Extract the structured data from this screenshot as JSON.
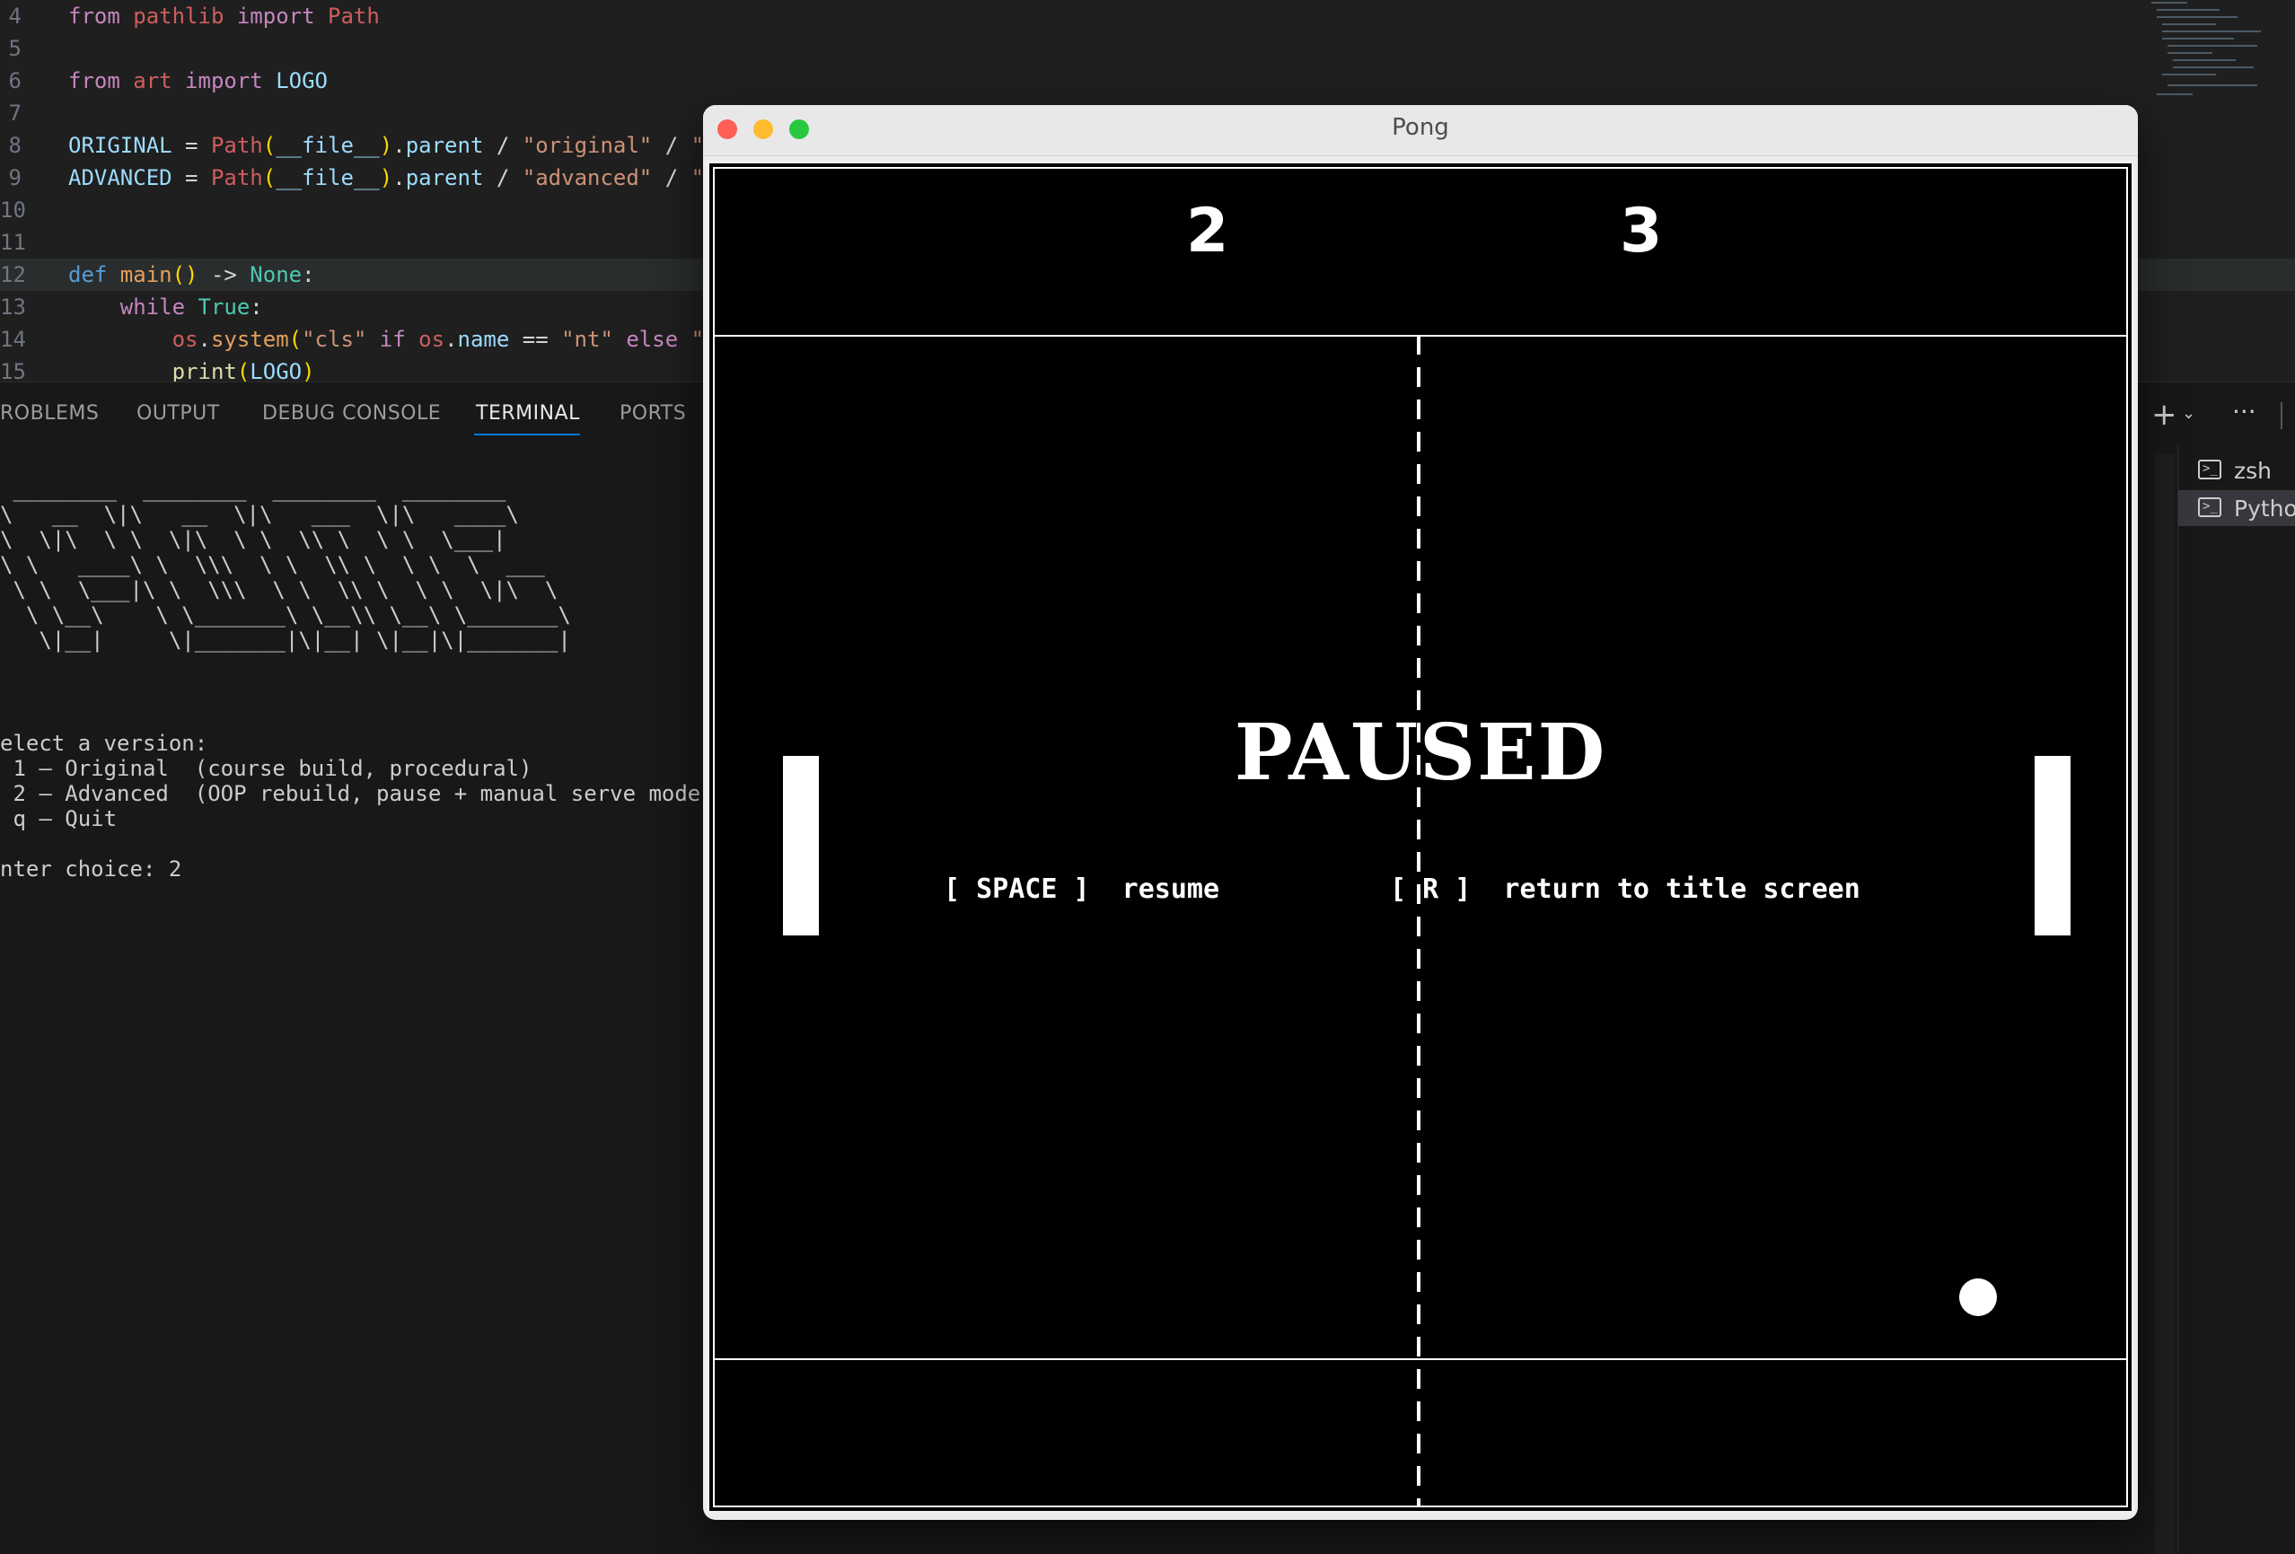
{
  "editor": {
    "lines": [
      {
        "num": "4",
        "tokens": [
          [
            "kw",
            "from "
          ],
          [
            "mod",
            "pathlib"
          ],
          [
            "kw",
            " import "
          ],
          [
            "mod",
            "Path"
          ]
        ]
      },
      {
        "num": "5",
        "tokens": []
      },
      {
        "num": "6",
        "tokens": [
          [
            "kw",
            "from "
          ],
          [
            "mod",
            "art"
          ],
          [
            "kw",
            " import "
          ],
          [
            "var",
            "LOGO"
          ]
        ]
      },
      {
        "num": "7",
        "tokens": []
      },
      {
        "num": "8",
        "tokens": [
          [
            "var",
            "ORIGINAL"
          ],
          [
            "op",
            " = "
          ],
          [
            "mod",
            "Path"
          ],
          [
            "paren",
            "("
          ],
          [
            "var",
            "__file__"
          ],
          [
            "paren",
            ")"
          ],
          [
            "op",
            "."
          ],
          [
            "var",
            "parent"
          ],
          [
            "op",
            " / "
          ],
          [
            "str",
            "\"original\""
          ],
          [
            "op",
            " / "
          ],
          [
            "str",
            "\""
          ]
        ]
      },
      {
        "num": "9",
        "tokens": [
          [
            "var",
            "ADVANCED"
          ],
          [
            "op",
            " = "
          ],
          [
            "mod",
            "Path"
          ],
          [
            "paren",
            "("
          ],
          [
            "var",
            "__file__"
          ],
          [
            "paren",
            ")"
          ],
          [
            "op",
            "."
          ],
          [
            "var",
            "parent"
          ],
          [
            "op",
            " / "
          ],
          [
            "str",
            "\"advanced\""
          ],
          [
            "op",
            " / "
          ],
          [
            "str",
            "\""
          ]
        ]
      },
      {
        "num": "10",
        "tokens": []
      },
      {
        "num": "11",
        "tokens": []
      },
      {
        "num": "12",
        "tokens": [
          [
            "def",
            "def "
          ],
          [
            "fn2",
            "main"
          ],
          [
            "paren",
            "()"
          ],
          [
            "op",
            " -> "
          ],
          [
            "bool",
            "None"
          ],
          [
            "op",
            ":"
          ]
        ]
      },
      {
        "num": "13",
        "tokens": [
          [
            "plain",
            "    "
          ],
          [
            "kw",
            "while "
          ],
          [
            "bool",
            "True"
          ],
          [
            "op",
            ":"
          ]
        ]
      },
      {
        "num": "14",
        "tokens": [
          [
            "plain",
            "        "
          ],
          [
            "mod",
            "os"
          ],
          [
            "op",
            "."
          ],
          [
            "fn2",
            "system"
          ],
          [
            "paren",
            "("
          ],
          [
            "str",
            "\"cls\""
          ],
          [
            "kw",
            " if "
          ],
          [
            "mod",
            "os"
          ],
          [
            "op",
            "."
          ],
          [
            "var",
            "name"
          ],
          [
            "op",
            " == "
          ],
          [
            "str",
            "\"nt\""
          ],
          [
            "kw",
            " else "
          ],
          [
            "str",
            "\""
          ]
        ]
      },
      {
        "num": "15",
        "tokens": [
          [
            "plain",
            "        "
          ],
          [
            "fn",
            "print"
          ],
          [
            "paren",
            "("
          ],
          [
            "var",
            "LOGO"
          ],
          [
            "paren",
            ")"
          ]
        ]
      }
    ]
  },
  "panel": {
    "tabs": [
      "ROBLEMS",
      "OUTPUT",
      "DEBUG CONSOLE",
      "TERMINAL",
      "PORTS"
    ],
    "active_tab": "TERMINAL",
    "terminals": [
      {
        "label": "zsh",
        "active": false
      },
      {
        "label": "Pytho",
        "active": true
      }
    ]
  },
  "terminal": {
    "logo": " ________  ________  ________  ________\n\\   __  \\|\\   __  \\|\\   ___  \\|\\   ____\\\n\\  \\|\\  \\ \\  \\|\\  \\ \\  \\\\ \\  \\ \\  \\___|\n\\ \\   ____\\ \\  \\\\\\  \\ \\  \\\\ \\  \\ \\  \\  ___\n \\ \\  \\___|\\ \\  \\\\\\  \\ \\  \\\\ \\  \\ \\  \\|\\  \\\n  \\ \\__\\    \\ \\_______\\ \\__\\\\ \\__\\ \\_______\\\n   \\|__|     \\|_______|\\|__| \\|__|\\|_______|",
    "menu": "elect a version:\n 1 — Original  (course build, procedural)\n 2 — Advanced  (OOP rebuild, pause + manual serve mode)\n q — Quit\n\nnter choice: 2"
  },
  "window": {
    "title": "Pong",
    "colors": {
      "close": "#fe5f57",
      "minimize": "#febc2e",
      "zoom": "#28c840"
    }
  },
  "game": {
    "score_left": "2",
    "score_right": "3",
    "paused_title": "PAUSED",
    "hint_resume": "[ SPACE ]  resume",
    "hint_return": "[ R ]  return to title screen"
  }
}
